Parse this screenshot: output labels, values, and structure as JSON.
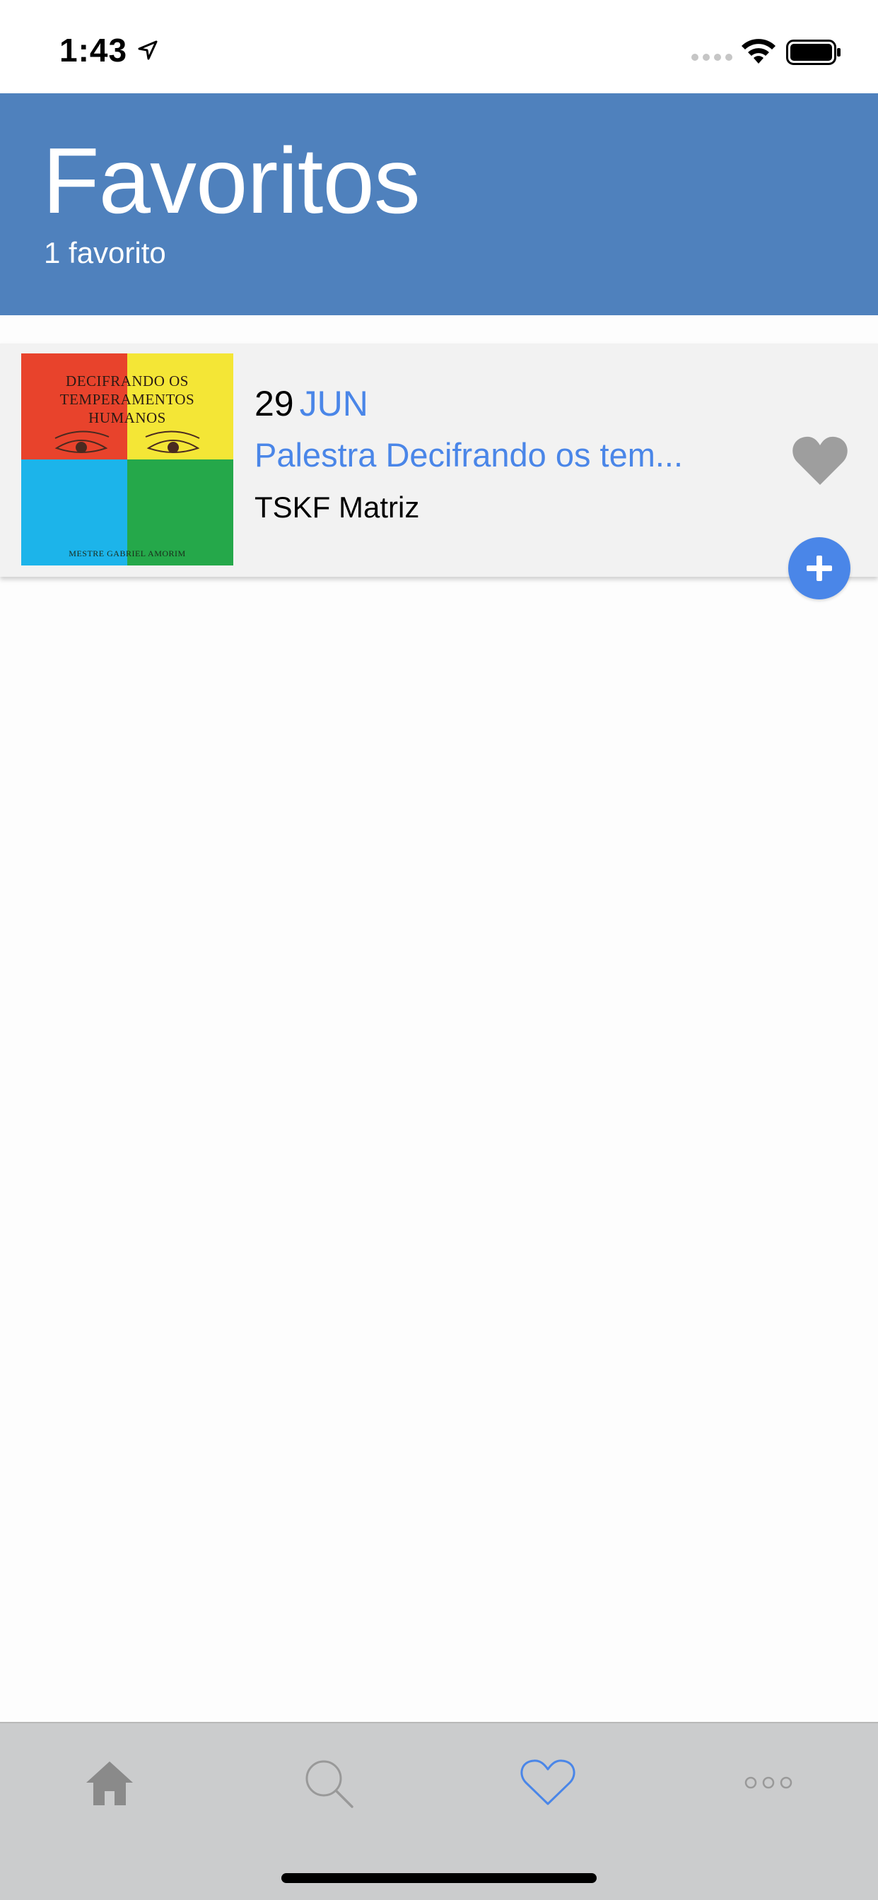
{
  "status_bar": {
    "time": "1:43"
  },
  "header": {
    "title": "Favoritos",
    "subtitle": "1 favorito"
  },
  "favorites": [
    {
      "thumbnail": {
        "title_text": "Decifrando Os Temperamentos Humanos",
        "author_text": "Mestre Gabriel Amorim"
      },
      "day": "29",
      "month": "JUN",
      "title": "Palestra Decifrando os tem...",
      "location": "TSKF Matriz",
      "favorited": true
    }
  ],
  "colors": {
    "header_bg": "#4f81bd",
    "accent": "#4a86e8",
    "card_bg": "#f2f2f2",
    "tab_bar_bg": "#cbcccd",
    "heart_icon": "#9e9e9e"
  },
  "tab_bar": {
    "items": [
      {
        "icon": "home-icon",
        "selected": false
      },
      {
        "icon": "search-icon",
        "selected": false
      },
      {
        "icon": "heart-icon",
        "selected": true
      },
      {
        "icon": "more-icon",
        "selected": false
      }
    ]
  }
}
